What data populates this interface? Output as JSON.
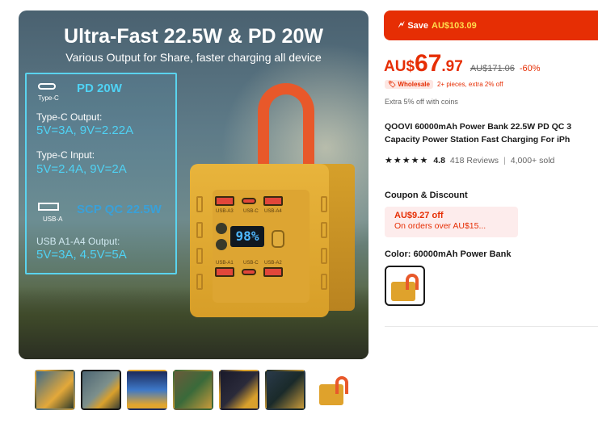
{
  "hero": {
    "title": "Ultra-Fast 22.5W & PD 20W",
    "subtitle": "Various Output for Share, faster charging all device",
    "specs": [
      {
        "label": "PD 20W",
        "value": ""
      },
      {
        "label": "Type-C Output:",
        "value": "5V=3A, 9V=2.22A"
      },
      {
        "label": "Type-C  Input:",
        "value": "5V=2.4A, 9V=2A"
      },
      {
        "label": "SCP QC 22.5W",
        "value": ""
      },
      {
        "label": "USB A1-A4  Output:",
        "value": "5V=3A, 4.5V=5A"
      }
    ],
    "port_labels": {
      "typec": "Type-C",
      "usba": "USB-A"
    },
    "screen": "98%",
    "device_labels": [
      "USB-A3",
      "USB-C",
      "USB-A4",
      "USB-A1",
      "USB-C",
      "USB-A2"
    ]
  },
  "thumbnails": [
    "thumb-1",
    "thumb-2",
    "thumb-3",
    "thumb-4",
    "thumb-5",
    "thumb-6",
    "thumb-7"
  ],
  "active_thumb": 1,
  "save": {
    "prefix": "Save",
    "amount": "AU$103.09"
  },
  "price": {
    "currency": "AU$",
    "integer": "67",
    "decimal": ".97",
    "original": "AU$171.06",
    "discount": "-60%"
  },
  "wholesale": {
    "badge": "Wholesale",
    "text": "2+ pieces, extra 2% off"
  },
  "coins_text": "Extra 5% off with coins",
  "product_title_line1": "QOOVI 60000mAh Power Bank 22.5W PD QC 3",
  "product_title_line2": "Capacity Power Station Fast Charging For iPh",
  "rating": {
    "stars": "★★★★★",
    "value": "4.8",
    "reviews": "418 Reviews",
    "separator": "|",
    "sold": "4,000+ sold"
  },
  "coupon": {
    "heading": "Coupon & Discount",
    "amount": "AU$9.27 off",
    "condition": "On orders over AU$15..."
  },
  "color": {
    "heading": "Color: 60000mAh Power Bank"
  },
  "colors": {
    "accent": "#e62e04",
    "cyan": "#4fd2f4",
    "bank": "#e0a52e",
    "handle": "#e8582a"
  }
}
